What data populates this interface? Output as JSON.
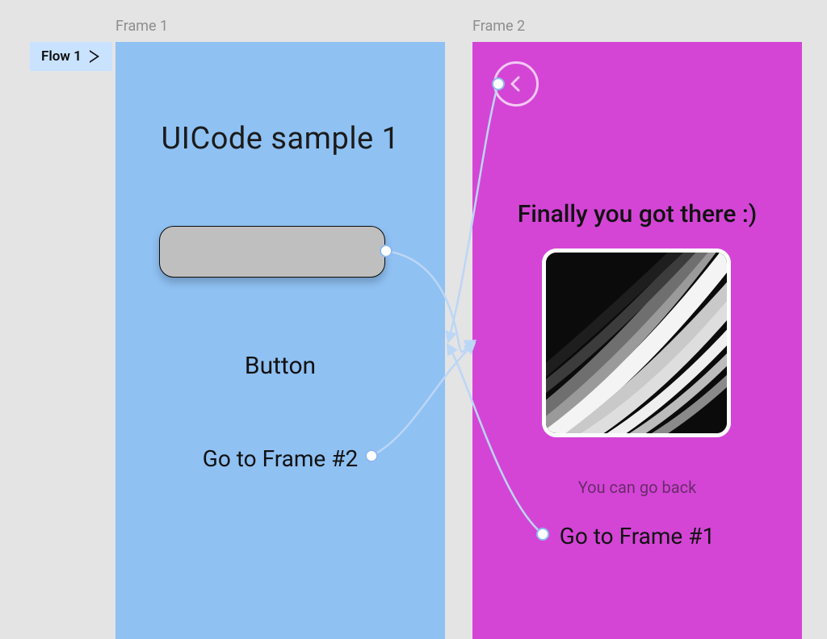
{
  "flow": {
    "label": "Flow 1"
  },
  "frames": {
    "frame1": {
      "label": "Frame 1",
      "title": "UICode sample 1",
      "button_text": "Button",
      "link_text": "Go to Frame #2"
    },
    "frame2": {
      "label": "Frame 2",
      "title": "Finally you got there :)",
      "caption": "You can go back",
      "link_text": "Go to Frame #1"
    }
  }
}
